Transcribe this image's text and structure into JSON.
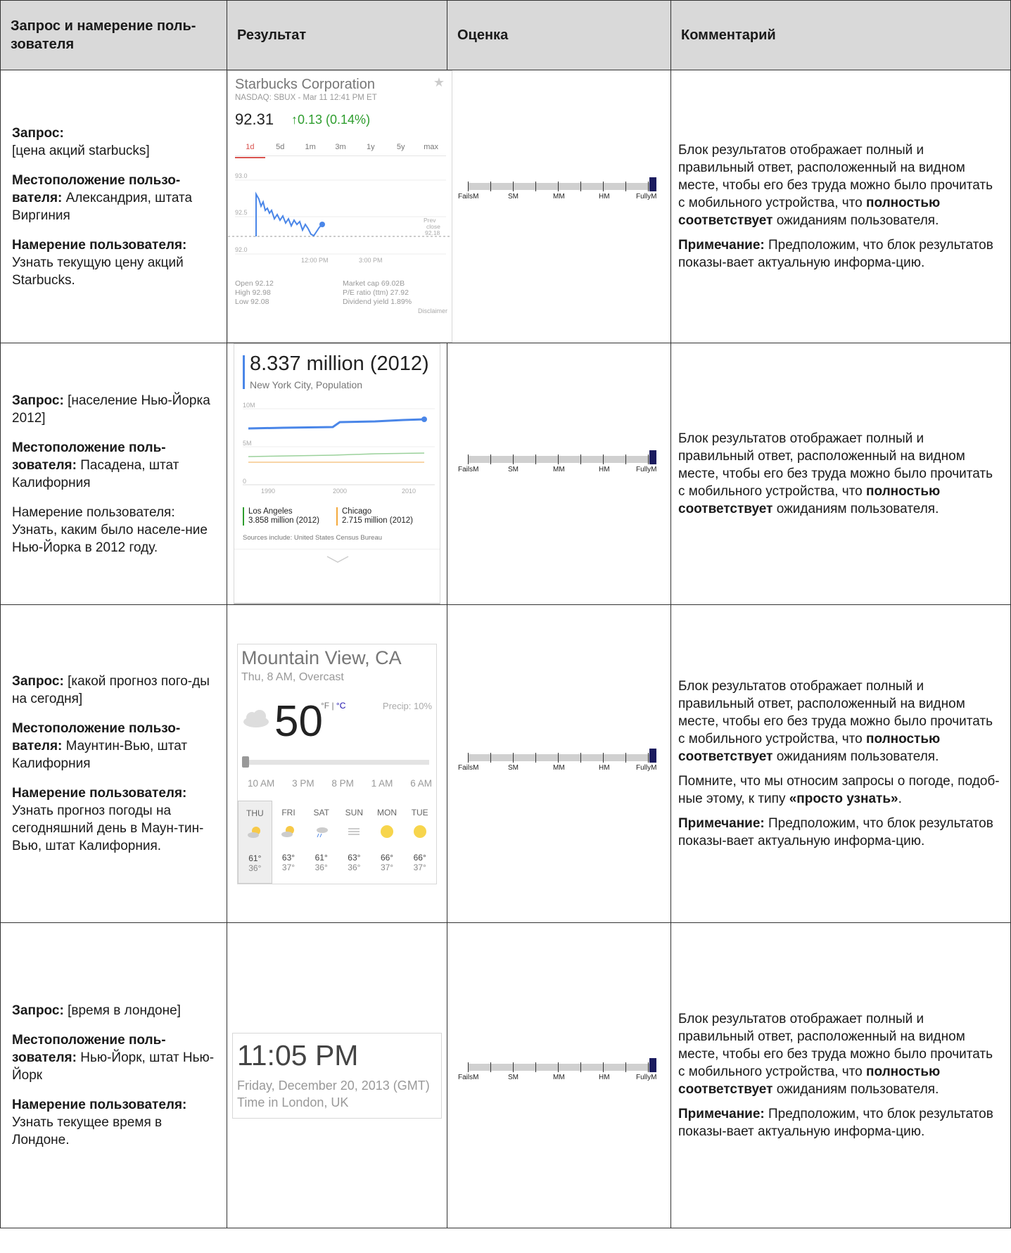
{
  "headers": {
    "query": "Запрос и намерение поль-зователя",
    "result": "Результат",
    "rating": "Оценка",
    "comment": "Комментарий"
  },
  "scale_labels": [
    "FailsM",
    "SM",
    "MM",
    "HM",
    "FullyM"
  ],
  "rows": [
    {
      "query_label": "Запрос:",
      "query": "[цена акций starbucks]",
      "location_label": "Местоположение пользо-вателя:",
      "location": " Александрия, штата Виргиния",
      "intent_label": "Намерение пользователя:",
      "intent": "Узнать текущую цену акций Starbucks.",
      "rating": "FullyM",
      "comment_a": "Блок результатов отображает полный и правильный ответ, расположенный на видном месте, чтобы его без труда можно было прочитать с мобильного устройства, что ",
      "comment_bold": "полностью соответствует",
      "comment_b": " ожиданиям пользователя.",
      "note_label": "Примечание:",
      "note": " Предположим, что блок результатов показы-вает актуальную информа-цию."
    },
    {
      "query_label": "Запрос:",
      "query": " [население Нью-Йорка 2012]",
      "location_label": "Местоположение поль-зователя:",
      "location": " Пасадена, штат Калифорния",
      "intent_plain": "Намерение пользователя: Узнать, каким было населе-ние Нью-Йорка в 2012 году.",
      "rating": "FullyM",
      "comment_a": "Блок результатов отображает полный и правильный ответ, расположенный на видном месте, чтобы его без труда можно было прочитать с мобильного устройства, что ",
      "comment_bold": "полностью соответствует",
      "comment_b": " ожиданиям пользователя."
    },
    {
      "query_label": "Запрос:",
      "query": " [какой прогноз пого-ды на сегодня]",
      "location_label": "Местоположение пользо-вателя:",
      "location": " Маунтин-Вью, штат Калифорния",
      "intent_label": "Намерение пользователя:",
      "intent": "Узнать прогноз погоды на сегодняшний день в Маун-тин-Вью, штат Калифорния.",
      "rating": "FullyM",
      "comment_a": "Блок результатов отображает полный и правильный ответ, расположенный на видном месте, чтобы его без труда можно было прочитать с мобильного устройства, что ",
      "comment_bold": "полностью соответствует",
      "comment_b": " ожиданиям пользователя.",
      "remember_a": "Помните, что мы относим запросы о погоде, подоб-ные этому, к типу ",
      "remember_bold": "«просто узнать»",
      "remember_b": ".",
      "note_label": "Примечание:",
      "note": " Предположим, что блок результатов показы-вает актуальную информа-цию."
    },
    {
      "query_label": "Запрос:",
      "query": " [время в лондоне]",
      "location_label": "Местоположение поль-зователя:",
      "location": " Нью-Йорк, штат Нью-Йорк",
      "intent_label": "Намерение пользователя:",
      "intent": "Узнать текущее время в Лондоне.",
      "rating": "FullyM",
      "comment_a": "Блок результатов отображает полный и правильный ответ, расположенный на видном месте, чтобы его без труда можно было прочитать с мобильного устройства, что ",
      "comment_bold": "полностью соответствует",
      "comment_b": " ожиданиям пользователя.",
      "note_label": "Примечание:",
      "note": " Предположим, что блок результатов показы-вает актуальную информа-цию."
    }
  ],
  "stock": {
    "title": "Starbucks Corporation",
    "subtitle": "NASDAQ: SBUX - Mar 11 12:41 PM ET",
    "price": "92.31",
    "change": "↑0.13 (0.14%)",
    "tabs": [
      "1d",
      "5d",
      "1m",
      "3m",
      "1y",
      "5y",
      "max"
    ],
    "y_labels": [
      "93.0",
      "92.5",
      "92.0"
    ],
    "x_labels": [
      "12:00 PM",
      "3:00 PM"
    ],
    "prev_close": [
      "Prev",
      "close",
      "92.18"
    ],
    "open": "Open  92.12",
    "high": "High  92.98",
    "low": "Low   92.08",
    "mktcap": "Market cap    69.02B",
    "pe": "P/E ratio (ttm)  27.92",
    "div": "Dividend yield  1.89%",
    "disclaimer": "Disclaimer"
  },
  "population": {
    "big": "8.337 million (2012)",
    "sub": "New York City, Population",
    "y_labels": [
      "10M",
      "5M",
      "0"
    ],
    "x_labels": [
      "1990",
      "2000",
      "2010"
    ],
    "la_name": "Los Angeles",
    "la_value": "3.858 million (2012)",
    "chi_name": "Chicago",
    "chi_value": "2.715 million (2012)",
    "sources": "Sources include: United States Census Bureau"
  },
  "weather": {
    "city": "Mountain View, CA",
    "sub": "Thu, 8 AM, Overcast",
    "temp": "50",
    "unit_f": "°F | ",
    "unit_c": "°C",
    "precip": "Precip: 10%",
    "hours": [
      "10 AM",
      "3 PM",
      "8 PM",
      "1 AM",
      "6 AM"
    ],
    "days": [
      {
        "name": "THU",
        "hi": "61°",
        "lo": "36°",
        "icon": "partly-cloudy"
      },
      {
        "name": "FRI",
        "hi": "63°",
        "lo": "37°",
        "icon": "partly-cloudy"
      },
      {
        "name": "SAT",
        "hi": "61°",
        "lo": "36°",
        "icon": "rain"
      },
      {
        "name": "SUN",
        "hi": "63°",
        "lo": "36°",
        "icon": "fog"
      },
      {
        "name": "MON",
        "hi": "66°",
        "lo": "37°",
        "icon": "sun"
      },
      {
        "name": "TUE",
        "hi": "66°",
        "lo": "37°",
        "icon": "sun"
      }
    ]
  },
  "clock": {
    "time": "11:05 PM",
    "date": "Friday, December 20, 2013 (GMT)",
    "place": "Time in London, UK"
  }
}
